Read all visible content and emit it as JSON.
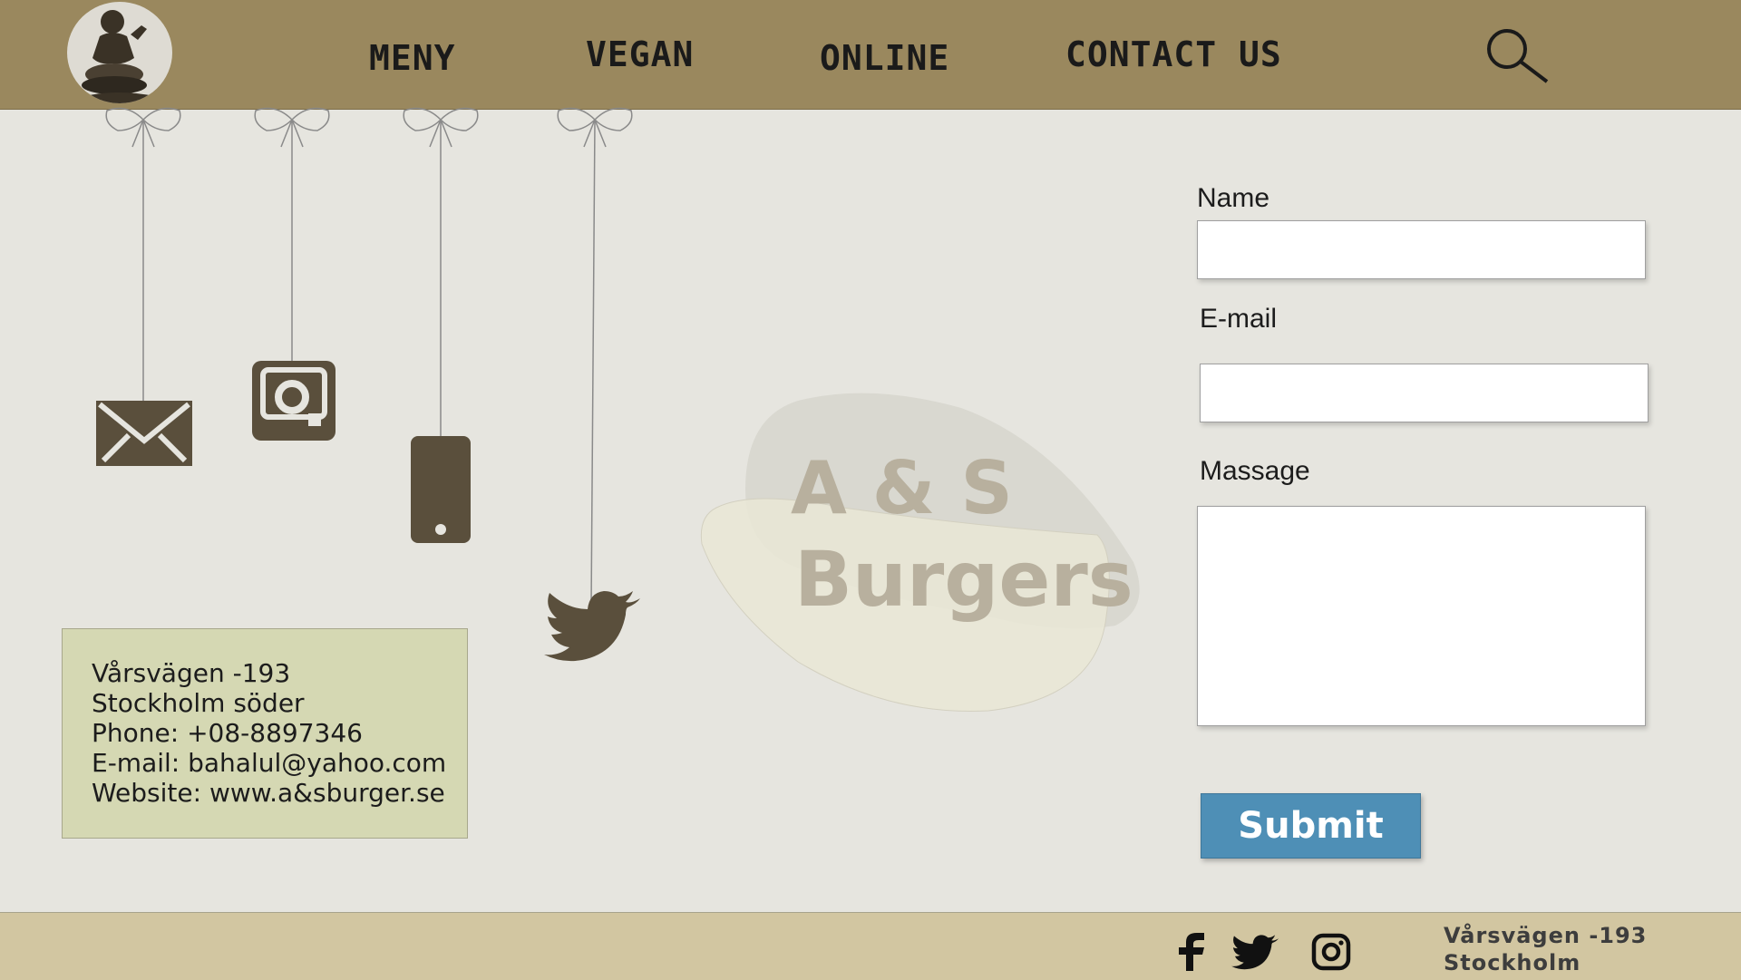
{
  "header": {
    "nav": [
      {
        "label": "MENY"
      },
      {
        "label": "VEGAN"
      },
      {
        "label": "ONLINE"
      },
      {
        "label": "CONTACT US"
      }
    ]
  },
  "contact_icons": [
    "envelope-icon",
    "camera-icon",
    "phone-icon",
    "twitter-bird-icon"
  ],
  "address": {
    "street": "Vårsvägen -193",
    "area": "Stockholm söder",
    "phone": "Phone: +08-8897346",
    "email": "E-mail: bahalul@yahoo.com",
    "website": "Website: www.a&sburger.se"
  },
  "brand": {
    "line1": "A & S",
    "line2": "Burgers"
  },
  "form": {
    "name_label": "Name",
    "email_label": "E-mail",
    "message_label": "Massage",
    "name_value": "",
    "email_value": "",
    "message_value": "",
    "submit_label": "Submit"
  },
  "footer": {
    "social_icons": [
      "facebook-icon",
      "twitter-icon",
      "instagram-icon"
    ],
    "address_line1": "Vårsvägen -193",
    "address_line2": "Stockholm"
  },
  "colors": {
    "header_bg": "#9a885e",
    "page_bg": "#e6e5df",
    "footer_bg": "#d2c6a1",
    "address_box_bg": "#d5d8b3",
    "icon_dark": "#5a4f3c",
    "submit_bg": "#4e8fb6"
  }
}
